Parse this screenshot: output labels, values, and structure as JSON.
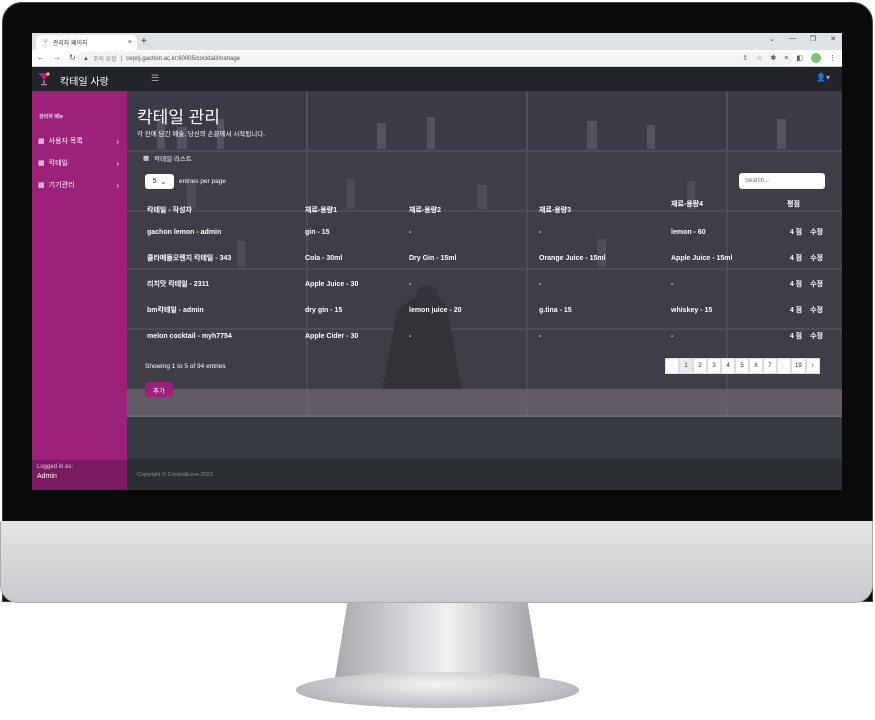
{
  "browser": {
    "tab_title": "관리자 페이지",
    "url_prefix": "주의 요함",
    "url": "cepnj.gachon.ac.kr:60005/cocktail/manage"
  },
  "navbar": {
    "brand": "칵테일 사랑"
  },
  "sidebar": {
    "heading": "관리자 메뉴",
    "items": [
      {
        "label": "사용자 목록"
      },
      {
        "label": "칵테일"
      },
      {
        "label": "기기관리"
      }
    ],
    "logged_in_label": "Logged in as:",
    "logged_in_user": "Admin"
  },
  "page": {
    "title": "칵테일 관리",
    "subtitle": "각 잔에 담긴 예술, 당신의 손끝에서 시작됩니다.",
    "card_header": "칵테일 리스트"
  },
  "table_controls": {
    "page_size": "5",
    "entries_label": "entries per page",
    "search_placeholder": "Search...",
    "info": "Showing 1 to 5 of 94 entries",
    "add_label": "추가"
  },
  "table": {
    "headers": [
      "칵테일 - 작성자",
      "재료-용량1",
      "재료-용량2",
      "재료-용량3",
      "재료-용량4",
      "평점"
    ],
    "edit_label": "수정",
    "rows": [
      {
        "name": "gachon lemon - admin",
        "i1": "gin - 15",
        "i2": "-",
        "i3": "-",
        "i4": "lemon - 60",
        "rating": "4 점"
      },
      {
        "name": "클라메돌오렌지 칵테일 - 343",
        "i1": "Cola - 30ml",
        "i2": "Dry Gin - 15ml",
        "i3": "Orange Juice - 15ml",
        "i4": "Apple Juice - 15ml",
        "rating": "4 점"
      },
      {
        "name": "리치맛 칵테일 - 2311",
        "i1": "Apple Juice - 30",
        "i2": "-",
        "i3": "-",
        "i4": "-",
        "rating": "4 점"
      },
      {
        "name": "bm칵테일 - admin",
        "i1": "dry gin - 15",
        "i2": "lemon juice - 20",
        "i3": "g.tina - 15",
        "i4": "whiskey - 15",
        "rating": "4 점"
      },
      {
        "name": "melon cocktail - myh7754",
        "i1": "Apple Cider - 30",
        "i2": "-",
        "i3": "-",
        "i4": "-",
        "rating": "4 점"
      }
    ]
  },
  "pagination": {
    "prev": "‹",
    "pages": [
      "1",
      "2",
      "3",
      "4",
      "5",
      "6",
      "7"
    ],
    "ellipsis": "...",
    "last": "19",
    "next": "›",
    "active_page": "1"
  },
  "footer": {
    "copyright": "Copyright © CocktailLove 2023"
  },
  "colors": {
    "accent": "#9b2179",
    "navbar": "#212529",
    "footer": "#2b2f33"
  }
}
